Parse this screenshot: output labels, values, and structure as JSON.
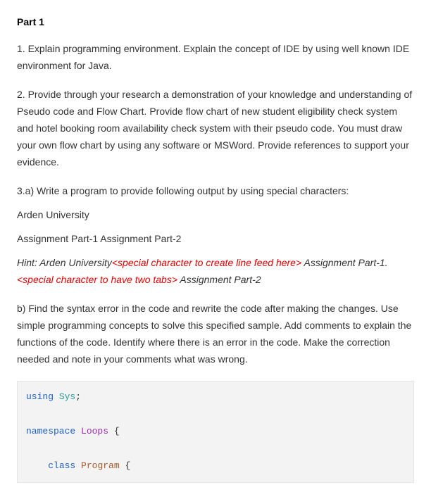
{
  "heading": "Part 1",
  "q1": "1. Explain programming environment. Explain the concept of IDE by using well known IDE environment for Java.",
  "q2": "2. Provide through your research a demonstration of your knowledge and understanding of Pseudo code and Flow Chart. Provide flow chart of new student eligibility check system and hotel booking room availability check system with their pseudo code. You must draw your own flow chart by using any software or MSWord. Provide references to support your evidence.",
  "q3a_intro": "3.a) Write a program to provide following output by using special characters:",
  "q3a_line1": "Arden University",
  "q3a_line2": "Assignment Part-1   Assignment Part-2",
  "hint": {
    "prefix": "Hint: Arden University",
    "red1": "<special character to create line feed here>",
    "mid": " Assignment Part-1. ",
    "red2": "<special character to have two tabs>",
    "suffix": " Assignment Part-2"
  },
  "q3b": "b) Find the syntax error in the code and rewrite the code after making the changes. Use simple programming concepts to solve this specified sample. Add comments to explain the functions of the code. Identify where there is an error in the code. Make the correction needed and note in your comments what was wrong.",
  "code": {
    "kw_using": "using",
    "sys": "Sys",
    "semicolon": ";",
    "kw_namespace": "namespace",
    "loops": "Loops",
    "brace_open1": " {",
    "kw_class": "class",
    "program": "Program",
    "brace_open2": " {"
  }
}
